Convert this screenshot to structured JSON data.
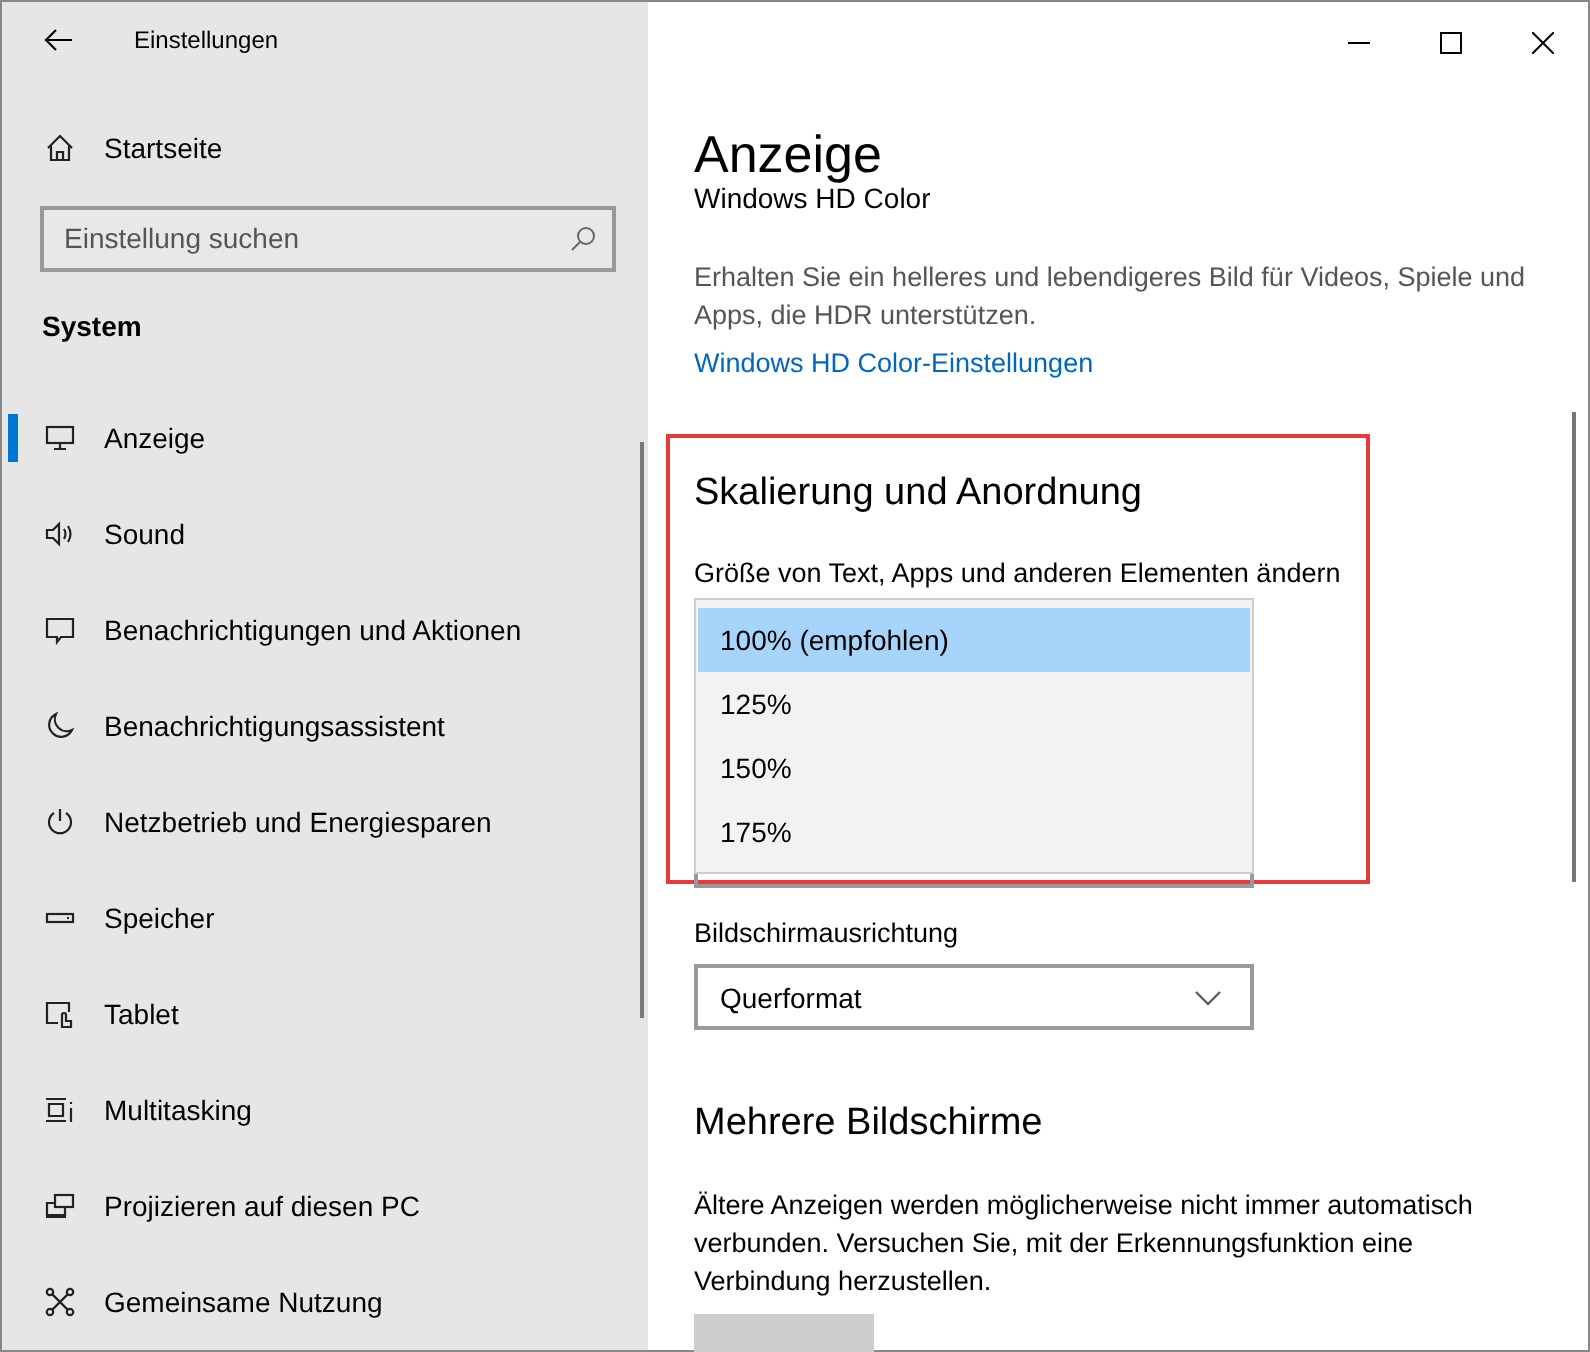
{
  "window": {
    "title": "Einstellungen"
  },
  "sidebar": {
    "home": {
      "label": "Startseite"
    },
    "search": {
      "placeholder": "Einstellung suchen"
    },
    "section": "System",
    "items": [
      {
        "label": "Anzeige",
        "selected": true
      },
      {
        "label": "Sound",
        "selected": false
      },
      {
        "label": "Benachrichtigungen und Aktionen",
        "selected": false
      },
      {
        "label": "Benachrichtigungsassistent",
        "selected": false
      },
      {
        "label": "Netzbetrieb und Energiesparen",
        "selected": false
      },
      {
        "label": "Speicher",
        "selected": false
      },
      {
        "label": "Tablet",
        "selected": false
      },
      {
        "label": "Multitasking",
        "selected": false
      },
      {
        "label": "Projizieren auf diesen PC",
        "selected": false
      },
      {
        "label": "Gemeinsame Nutzung",
        "selected": false
      }
    ]
  },
  "page": {
    "title": "Anzeige",
    "hd_color": {
      "heading": "Windows HD Color",
      "description": "Erhalten Sie ein helleres und lebendigeres Bild für Videos, Spiele und Apps, die HDR unterstützen.",
      "link": "Windows HD Color-Einstellungen"
    },
    "scaling": {
      "heading": "Skalierung und Anordnung",
      "label": "Größe von Text, Apps und anderen Elementen ändern",
      "options": [
        {
          "label": "100% (empfohlen)",
          "selected": true
        },
        {
          "label": "125%",
          "selected": false
        },
        {
          "label": "150%",
          "selected": false
        },
        {
          "label": "175%",
          "selected": false
        }
      ]
    },
    "orientation": {
      "label": "Bildschirmausrichtung",
      "value": "Querformat"
    },
    "multiple_displays": {
      "heading": "Mehrere Bildschirme",
      "description": "Ältere Anzeigen werden möglicherweise nicht immer automatisch verbunden. Versuchen Sie, mit der Erkennungsfunktion eine Verbindung herzustellen."
    }
  }
}
